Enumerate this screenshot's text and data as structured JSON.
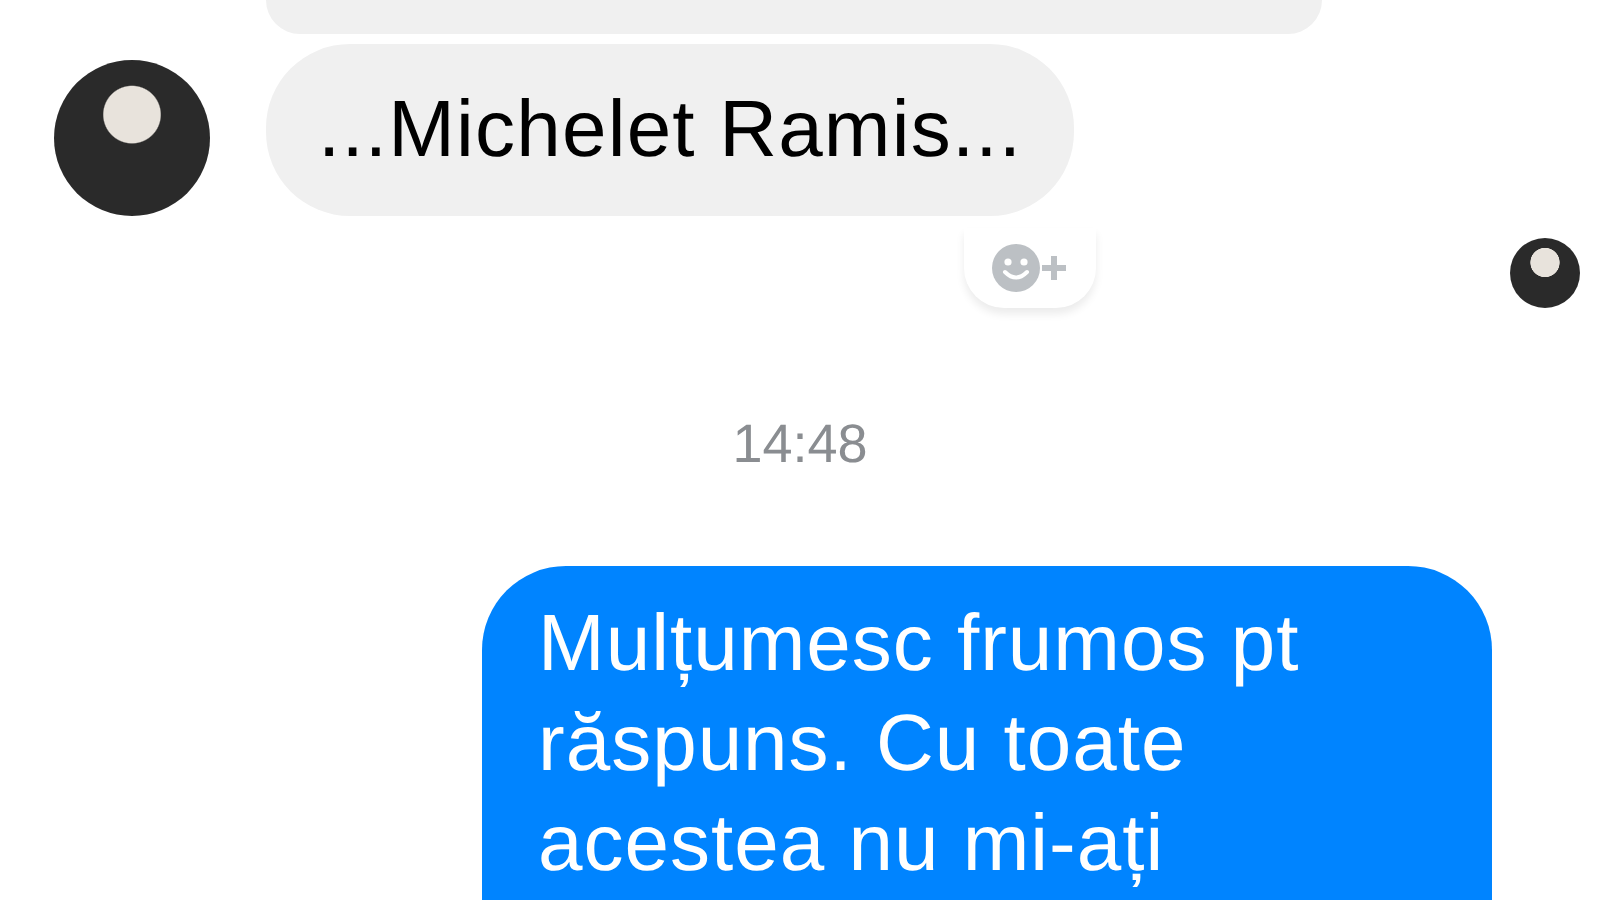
{
  "messages": [
    {
      "kind": "partial"
    },
    {
      "kind": "incoming",
      "text": "...Michelet Ramis..."
    },
    {
      "kind": "seen"
    },
    {
      "kind": "time",
      "text": "14:48"
    },
    {
      "kind": "outgoing",
      "text": "Mulțumesc frumos pt răspuns. Cu toate acestea nu mi-ați"
    }
  ]
}
